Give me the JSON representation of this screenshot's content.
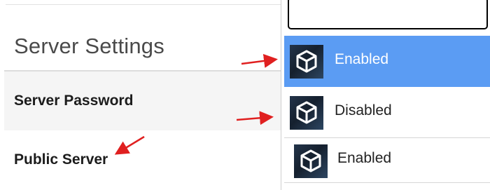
{
  "settings": {
    "section_title": "Server Settings",
    "rows": [
      {
        "label": "Server Password"
      },
      {
        "label": "Public Server"
      }
    ]
  },
  "dropdown": {
    "search_value": "",
    "options": [
      {
        "label": "Enabled",
        "icon": "box-icon",
        "highlighted": true
      },
      {
        "label": "Disabled",
        "icon": "box-icon",
        "highlighted": false
      }
    ],
    "selected": {
      "label": "Enabled",
      "icon": "box-icon"
    }
  },
  "colors": {
    "highlight": "#5b9cf3",
    "arrow": "#e02020"
  }
}
